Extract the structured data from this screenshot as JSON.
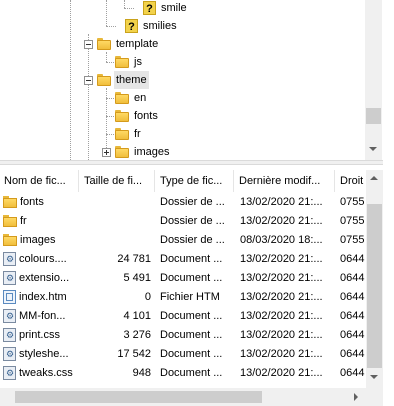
{
  "tree": {
    "nodes": [
      {
        "label": "smile",
        "icon": "question-icon"
      },
      {
        "label": "smilies",
        "icon": "question-icon"
      },
      {
        "label": "template",
        "icon": "folder-icon"
      },
      {
        "label": "js",
        "icon": "folder-icon"
      },
      {
        "label": "theme",
        "icon": "folder-icon",
        "selected": true
      },
      {
        "label": "en",
        "icon": "folder-icon"
      },
      {
        "label": "fonts",
        "icon": "folder-icon"
      },
      {
        "label": "fr",
        "icon": "folder-icon"
      },
      {
        "label": "images",
        "icon": "folder-icon"
      }
    ]
  },
  "list": {
    "columns": [
      "Nom de fic...",
      "Taille de fi...",
      "Type de fic...",
      "Dernière modif...",
      "Droit"
    ],
    "rows": [
      {
        "name": "fonts",
        "size": "",
        "type": "Dossier de ...",
        "modified": "13/02/2020 21:...",
        "rights": "0755",
        "icon": "folder-icon"
      },
      {
        "name": "fr",
        "size": "",
        "type": "Dossier de ...",
        "modified": "13/02/2020 21:...",
        "rights": "0755",
        "icon": "folder-icon"
      },
      {
        "name": "images",
        "size": "",
        "type": "Dossier de ...",
        "modified": "08/03/2020 18:...",
        "rights": "0755",
        "icon": "folder-icon"
      },
      {
        "name": "colours....",
        "size": "24 781",
        "type": "Document ...",
        "modified": "13/02/2020 21:...",
        "rights": "0644",
        "icon": "css-file-icon"
      },
      {
        "name": "extensio...",
        "size": "5 491",
        "type": "Document ...",
        "modified": "13/02/2020 21:...",
        "rights": "0644",
        "icon": "css-file-icon"
      },
      {
        "name": "index.htm",
        "size": "0",
        "type": "Fichier HTM",
        "modified": "13/02/2020 21:...",
        "rights": "0644",
        "icon": "htm-file-icon"
      },
      {
        "name": "MM-fon...",
        "size": "4 101",
        "type": "Document ...",
        "modified": "13/02/2020 21:...",
        "rights": "0644",
        "icon": "css-file-icon"
      },
      {
        "name": "print.css",
        "size": "3 276",
        "type": "Document ...",
        "modified": "13/02/2020 21:...",
        "rights": "0644",
        "icon": "css-file-icon"
      },
      {
        "name": "styleshe...",
        "size": "17 542",
        "type": "Document ...",
        "modified": "13/02/2020 21:...",
        "rights": "0644",
        "icon": "css-file-icon"
      },
      {
        "name": "tweaks.css",
        "size": "948",
        "type": "Document ...",
        "modified": "13/02/2020 21:...",
        "rights": "0644",
        "icon": "css-file-icon"
      }
    ]
  }
}
